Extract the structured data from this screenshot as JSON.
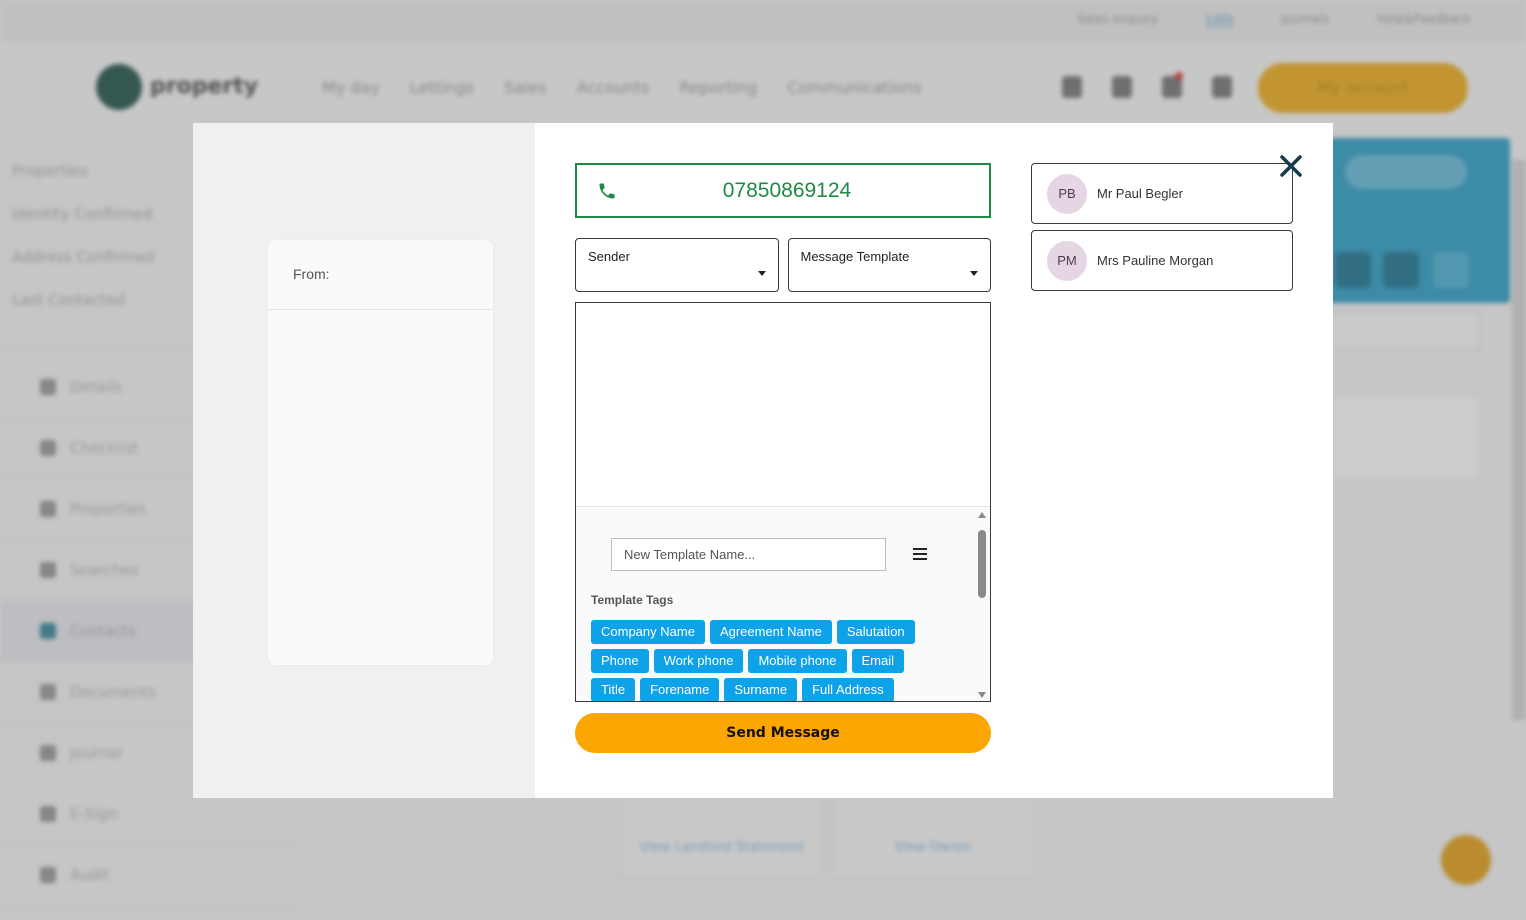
{
  "background": {
    "top_links": [
      "Sales enquiry",
      "Lists",
      "Journals",
      "Help&Feedback"
    ],
    "logo_text": "property",
    "nav": [
      "My day",
      "Lettings",
      "Sales",
      "Accounts",
      "Reporting",
      "Communications"
    ],
    "account_button": "My account",
    "info_rows": [
      "Properties",
      "Identity Confirmed",
      "Address Confirmed",
      "Last Contacted"
    ],
    "menu": [
      "Details",
      "Checklist",
      "Properties",
      "Searches",
      "Contacts",
      "Documents",
      "Journal",
      "E-Sign",
      "Audit"
    ],
    "bottom_links": [
      "View Landlord Statement",
      "View Owner"
    ]
  },
  "preview": {
    "from_label": "From:"
  },
  "compose": {
    "phone_number": "07850869124",
    "sender_label": "Sender",
    "template_label": "Message Template",
    "message_text": "",
    "new_template_placeholder": "New Template Name...",
    "tags_title": "Template Tags",
    "tags": [
      "Company Name",
      "Agreement Name",
      "Salutation",
      "Phone",
      "Work phone",
      "Mobile phone",
      "Email",
      "Title",
      "Forename",
      "Surname",
      "Full Address"
    ],
    "send_label": "Send Message"
  },
  "contacts": [
    {
      "initials": "PB",
      "name": "Mr Paul Begler"
    },
    {
      "initials": "PM",
      "name": "Mrs Pauline Morgan"
    }
  ],
  "colors": {
    "accent_green": "#1f8a47",
    "tag_blue": "#0ea2e8",
    "send_orange": "#fba601",
    "avatar_bg": "#e6d6e3",
    "close_icon": "#133a4a"
  }
}
